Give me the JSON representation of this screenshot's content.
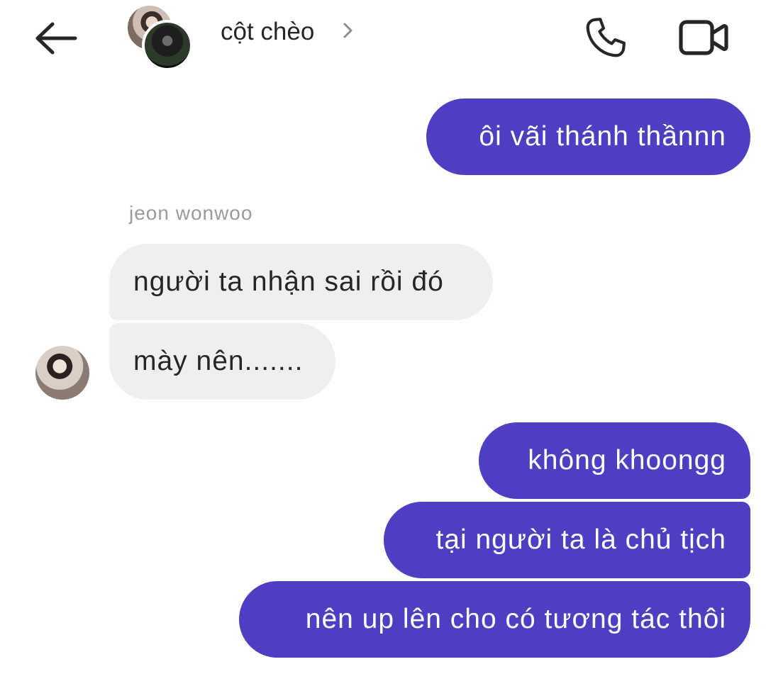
{
  "header": {
    "title": "cột chèo",
    "back_icon": "arrow-left-icon",
    "chevron_icon": "chevron-right-icon",
    "call_icon": "phone-icon",
    "video_icon": "video-camera-icon"
  },
  "messages": [
    {
      "direction": "out",
      "text": "ôi vãi thánh thầnnn"
    },
    {
      "direction": "in",
      "sender": "jeon wonwoo",
      "text": "người ta nhận sai rồi đó"
    },
    {
      "direction": "in",
      "text": "mày nên......."
    },
    {
      "direction": "out",
      "text": "không khoongg"
    },
    {
      "direction": "out",
      "text": "tại người ta là chủ tịch"
    },
    {
      "direction": "out",
      "text": "nên up lên cho có tương tác thôi"
    }
  ],
  "colors": {
    "outgoing_bubble": "#4d3ec2",
    "incoming_bubble": "#efefef",
    "text_primary": "#262626",
    "text_secondary": "#9a9a9a",
    "background": "#ffffff"
  }
}
